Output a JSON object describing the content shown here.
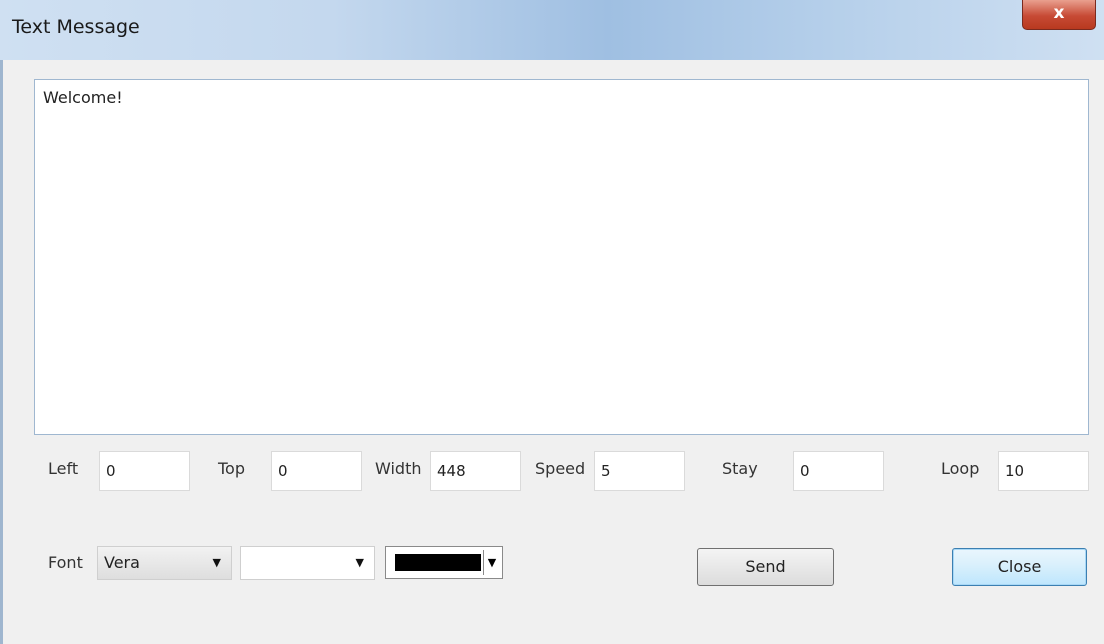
{
  "window": {
    "title": "Text Message",
    "close_glyph": "x"
  },
  "message": {
    "text": "Welcome!"
  },
  "params": {
    "left_label": "Left",
    "left_value": "0",
    "top_label": "Top",
    "top_value": "0",
    "width_label": "Width",
    "width_value": "448",
    "speed_label": "Speed",
    "speed_value": "5",
    "stay_label": "Stay",
    "stay_value": "0",
    "loop_label": "Loop",
    "loop_value": "10"
  },
  "font": {
    "label": "Font",
    "family_selected": "Vera",
    "size_selected": "",
    "color_selected": "#000000"
  },
  "buttons": {
    "send_label": "Send",
    "close_label": "Close"
  }
}
